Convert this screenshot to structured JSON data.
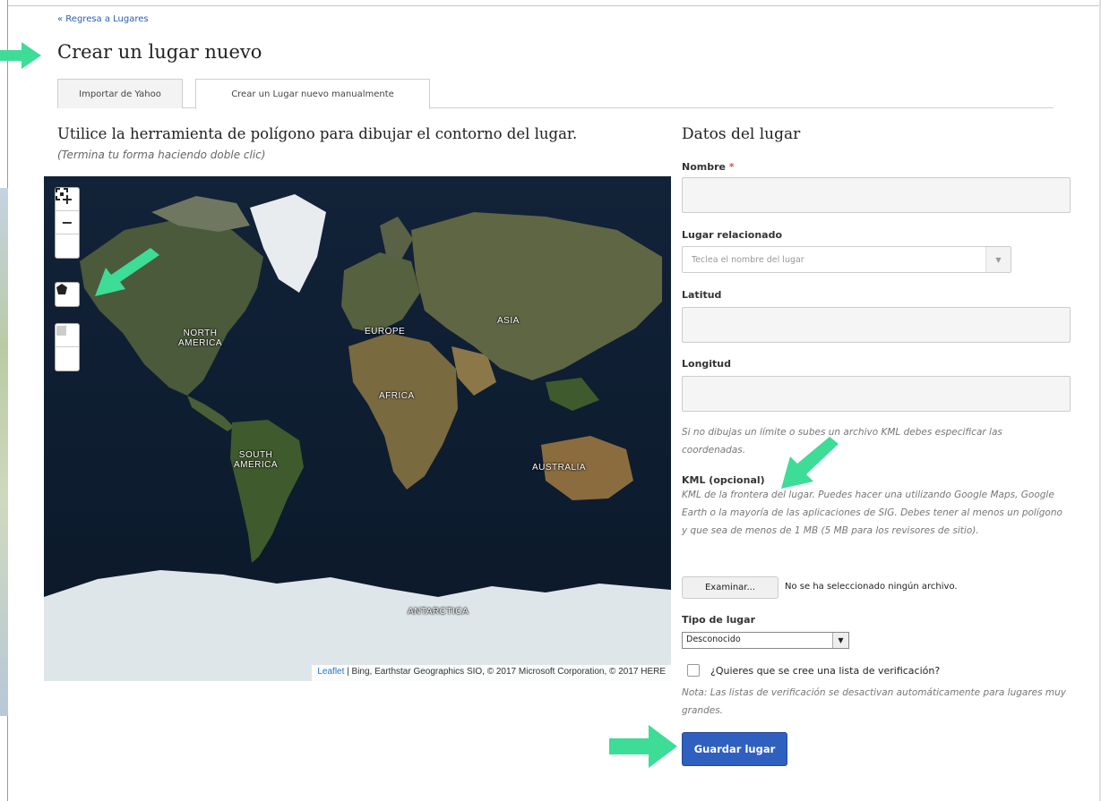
{
  "nav": {
    "back_link": "« Regresa a Lugares"
  },
  "page": {
    "title": "Crear un lugar nuevo"
  },
  "tabs": [
    {
      "label": "Importar de Yahoo",
      "active": false
    },
    {
      "label": "Crear un Lugar nuevo manualmente",
      "active": true
    }
  ],
  "map_section": {
    "heading": "Utilice la herramienta de polígono para dibujar el contorno del lugar.",
    "hint": "(Termina tu forma haciendo doble clic)",
    "controls": {
      "zoom_in": "+",
      "zoom_out": "−"
    },
    "labels": {
      "north_america": "NORTH\nAMERICA",
      "south_america": "SOUTH\nAMERICA",
      "europe": "EUROPE",
      "asia": "ASIA",
      "africa": "AFRICA",
      "australia": "AUSTRALIA",
      "antarctica": "ANTARCTICA"
    },
    "attribution_link": "Leaflet",
    "attribution_text": " | Bing, Earthstar Geographics SIO, © 2017 Microsoft Corporation, © 2017 HERE"
  },
  "form": {
    "heading": "Datos del lugar",
    "name_label": "Nombre",
    "required_mark": "*",
    "related_label": "Lugar relacionado",
    "related_placeholder": "Teclea el nombre del lugar",
    "lat_label": "Latitud",
    "lng_label": "Longitud",
    "coords_help": "Si no dibujas un límite o subes un archivo KML debes especificar las coordenadas.",
    "kml_label": "KML (opcional)",
    "kml_help": "KML de la frontera del lugar. Puedes hacer una utilizando Google Maps, Google Earth o la mayoría de las aplicaciones de SIG. Debes tener al menos un polígono y que sea de menos de 1 MB (5 MB para los revisores de sitio).",
    "file_button": "Examinar...",
    "file_status": "No se ha seleccionado ningún archivo.",
    "type_label": "Tipo de lugar",
    "type_value": "Desconocido",
    "checklist_label": "¿Quieres que se cree una lista de verificación?",
    "checklist_note": "Nota: Las listas de verificación se desactivan automáticamente para lugares muy grandes.",
    "checklist_checked": false,
    "save_button": "Guardar lugar"
  },
  "colors": {
    "link": "#2a5db0",
    "primary_button": "#2f5fbf",
    "annotation_arrow": "#3ddc97",
    "required": "#d9534f"
  }
}
